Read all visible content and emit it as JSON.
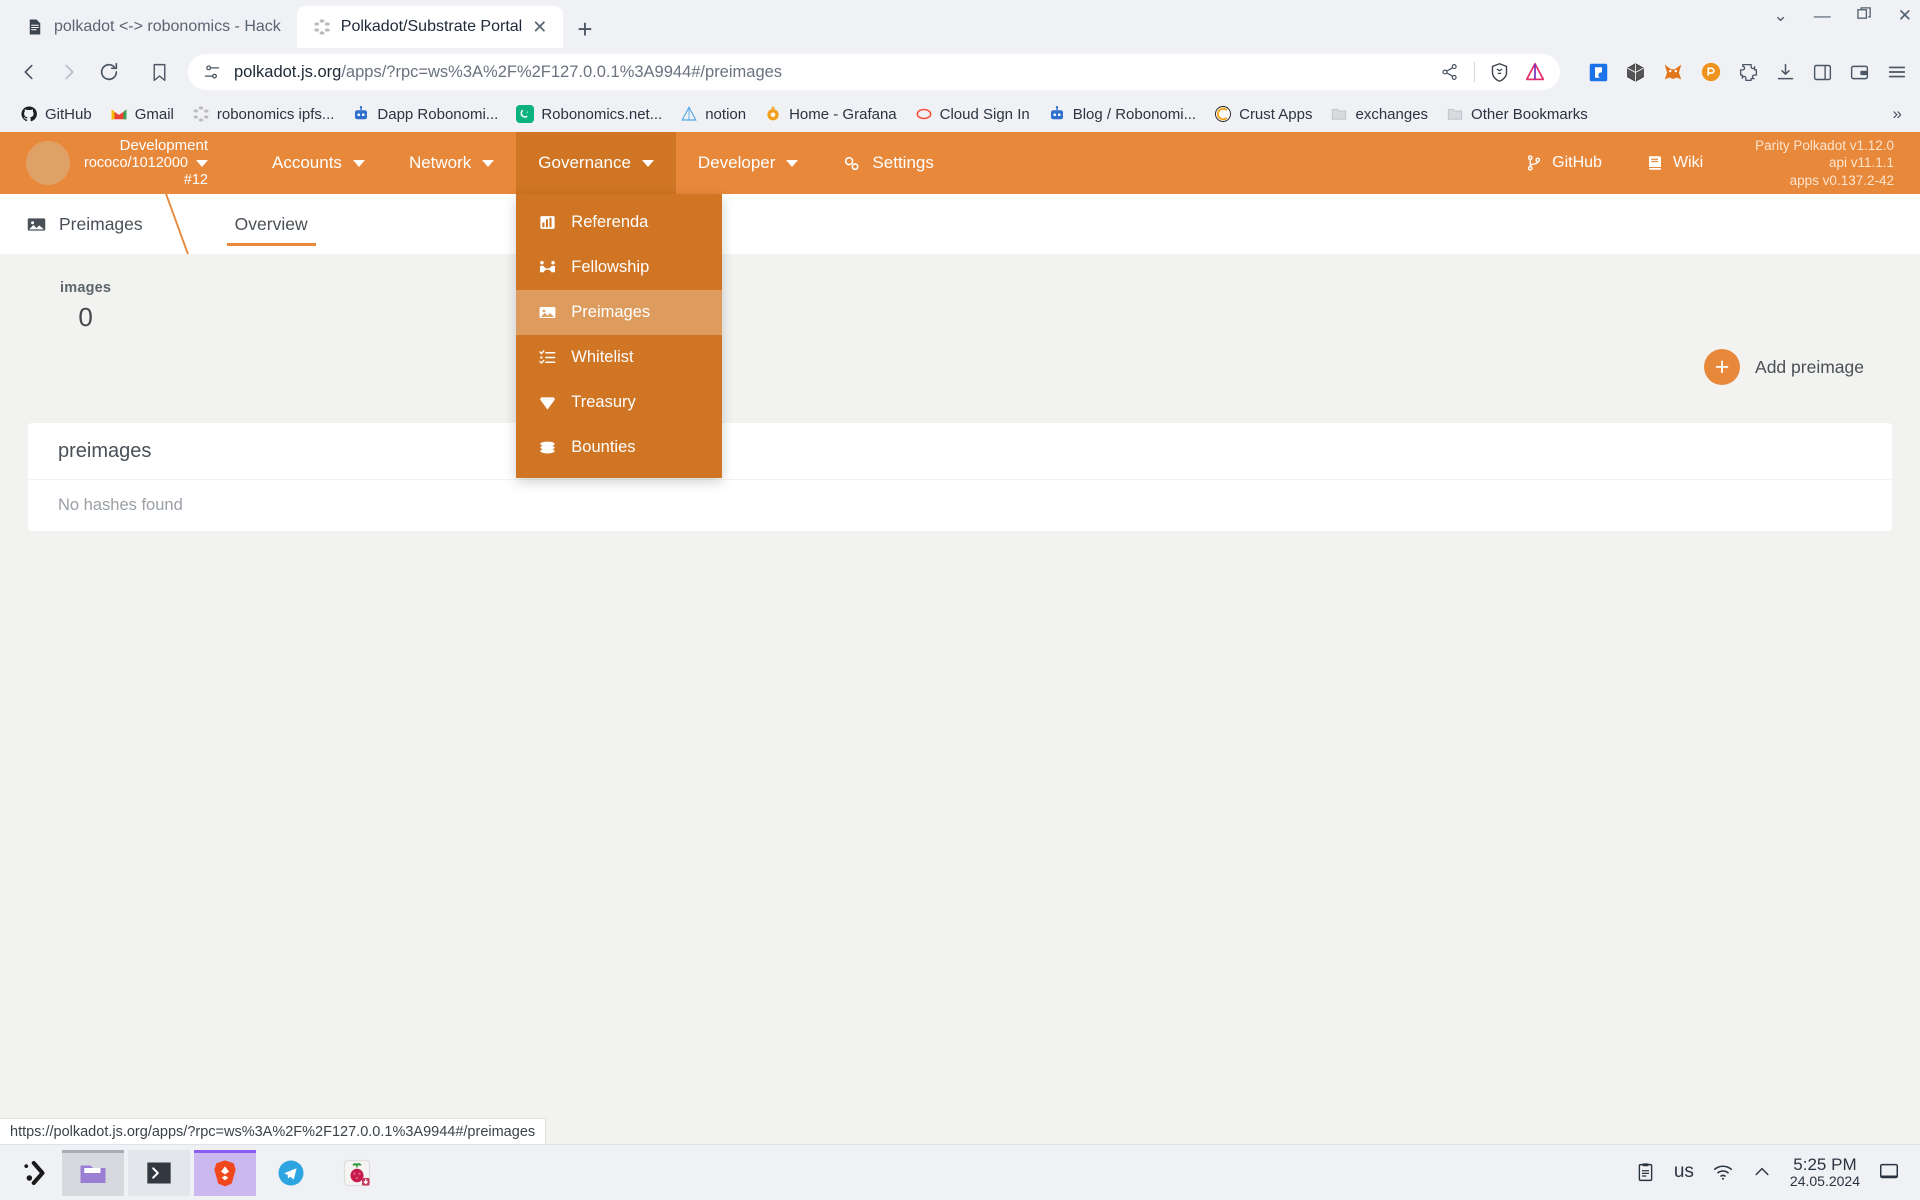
{
  "browser": {
    "tabs": [
      {
        "title": "polkadot <-> robonomics - Hack",
        "icon": "document-icon",
        "active": false
      },
      {
        "title": "Polkadot/Substrate Portal",
        "icon": "polkadot-icon",
        "active": true
      }
    ],
    "new_tab_label": "+",
    "window_controls": {
      "minimize": "—",
      "maximize": "❐",
      "close": "✕",
      "tab_search": "⌄"
    },
    "nav": {
      "back": "‹",
      "forward": "›",
      "reload": "reload-icon"
    },
    "url": {
      "domain": "polkadot.js.org",
      "path": "/apps/?rpc=ws%3A%2F%2F127.0.0.1%3A9944#/preimages",
      "full": "polkadot.js.org/apps/?rpc=ws%3A%2F%2F127.0.0.1%3A9944#/preimages"
    },
    "bookmarks": [
      {
        "label": "GitHub",
        "icon": "github-icon"
      },
      {
        "label": "Gmail",
        "icon": "gmail-icon"
      },
      {
        "label": "robonomics ipfs...",
        "icon": "polkadot-icon"
      },
      {
        "label": "Dapp Robonomi...",
        "icon": "robot-icon"
      },
      {
        "label": "Robonomics.net...",
        "icon": "robonomics-icon"
      },
      {
        "label": "notion",
        "icon": "notion-icon"
      },
      {
        "label": "Home - Grafana",
        "icon": "grafana-icon"
      },
      {
        "label": "Cloud Sign In",
        "icon": "cloud-icon"
      },
      {
        "label": "Blog / Robonomi...",
        "icon": "robot-icon"
      },
      {
        "label": "Crust Apps",
        "icon": "crust-icon"
      },
      {
        "label": "exchanges",
        "icon": "folder-icon"
      },
      {
        "label": "Other Bookmarks",
        "icon": "folder-icon"
      }
    ],
    "bookmarks_overflow": "»",
    "status_bar_url": "https://polkadot.js.org/apps/?rpc=ws%3A%2F%2F127.0.0.1%3A9944#/preimages"
  },
  "app": {
    "chain": {
      "name": "Development",
      "spec": "rococo/1012000",
      "block": "#12"
    },
    "nav_items": [
      {
        "label": "Accounts",
        "has_caret": true,
        "open": false
      },
      {
        "label": "Network",
        "has_caret": true,
        "open": false
      },
      {
        "label": "Governance",
        "has_caret": true,
        "open": true
      },
      {
        "label": "Developer",
        "has_caret": true,
        "open": false
      },
      {
        "label": "Settings",
        "has_caret": false,
        "open": false,
        "icon": "settings-icon"
      }
    ],
    "governance_menu": [
      {
        "label": "Referenda",
        "icon": "referenda-icon",
        "active": false
      },
      {
        "label": "Fellowship",
        "icon": "fellowship-icon",
        "active": false
      },
      {
        "label": "Preimages",
        "icon": "image-icon",
        "active": true
      },
      {
        "label": "Whitelist",
        "icon": "list-check-icon",
        "active": false
      },
      {
        "label": "Treasury",
        "icon": "diamond-icon",
        "active": false
      },
      {
        "label": "Bounties",
        "icon": "coins-icon",
        "active": false
      }
    ],
    "nav_right_links": [
      {
        "label": "GitHub",
        "icon": "git-branch-icon"
      },
      {
        "label": "Wiki",
        "icon": "book-icon"
      }
    ],
    "versions": {
      "node": "Parity Polkadot v1.12.0",
      "api": "api v11.1.1",
      "apps": "apps v0.137.2-42"
    },
    "breadcrumb": {
      "label": "Preimages",
      "icon": "image-icon"
    },
    "tabs": [
      {
        "label": "Overview",
        "active": true
      }
    ],
    "summary": [
      {
        "label": "images",
        "value": "0"
      }
    ],
    "add_button": {
      "label": "Add preimage",
      "icon": "plus-icon"
    },
    "table": {
      "header": "preimages",
      "empty_message": "No hashes found"
    },
    "colors": {
      "accent": "#e8883b",
      "menu_bg": "#cf7524",
      "menu_active": "#dd9b5d"
    }
  },
  "taskbar": {
    "launcher": "kde-launcher-icon",
    "tasks": [
      {
        "icon": "file-manager-icon",
        "state": "grey"
      },
      {
        "icon": "terminal-icon",
        "state": "grey2"
      },
      {
        "icon": "brave-icon",
        "state": "purple"
      },
      {
        "icon": "telegram-icon",
        "state": "none"
      },
      {
        "icon": "raspberry-pi-icon",
        "state": "none"
      }
    ],
    "tray": {
      "clipboard": "clipboard-icon",
      "keyboard_layout": "us",
      "wifi": "wifi-icon",
      "expand": "chevron-up-icon",
      "time": "5:25 PM",
      "date": "24.05.2024",
      "show_desktop": "show-desktop-icon"
    }
  }
}
